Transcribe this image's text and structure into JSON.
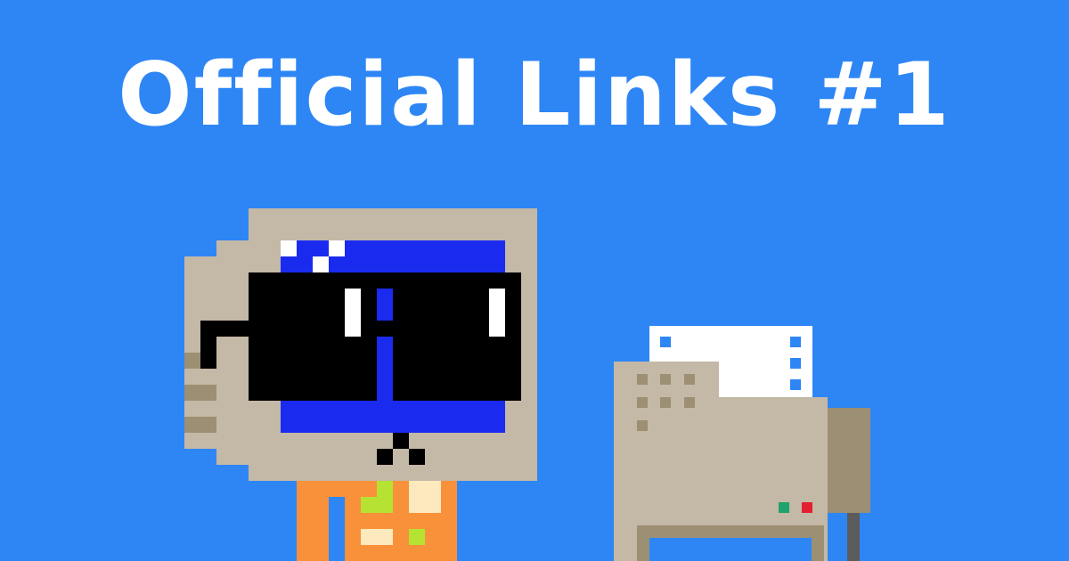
{
  "header": {
    "title": "Official Links #1"
  },
  "colors": {
    "background": "#2e86f5",
    "title": "#ffffff",
    "monitor_beige": "#c4b8a6",
    "monitor_shadow": "#9c8f73",
    "screen_blue": "#1a2bef",
    "sunglasses": "#000000",
    "shirt_orange": "#f9913a",
    "paper_white": "#ffffff",
    "led_green": "#1fa36b",
    "led_red": "#e3202f"
  },
  "illustration": {
    "character": "pixel-computer-mascot-with-sunglasses",
    "device": "pixel-printer"
  }
}
